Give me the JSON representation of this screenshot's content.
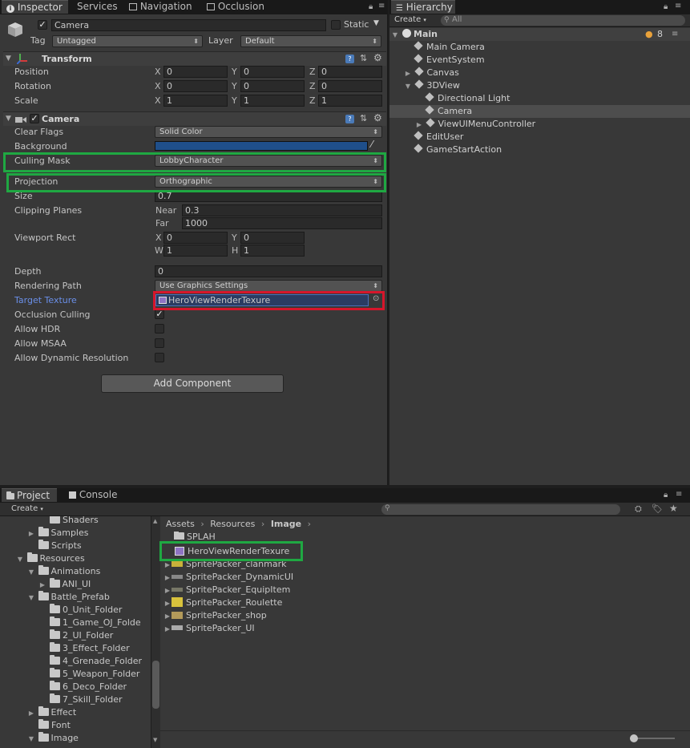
{
  "inspector_tabs": [
    {
      "label": "Inspector",
      "icon": "info-icon"
    },
    {
      "label": "Services",
      "icon": ""
    },
    {
      "label": "Navigation",
      "icon": "navigation-icon"
    },
    {
      "label": "Occlusion",
      "icon": "occlusion-icon"
    }
  ],
  "hierarchy_tab": {
    "label": "Hierarchy"
  },
  "object": {
    "name": "Camera",
    "active": true,
    "static_label": "Static",
    "tag_label": "Tag",
    "tag_value": "Untagged",
    "layer_label": "Layer",
    "layer_value": "Default"
  },
  "transform": {
    "title": "Transform",
    "rows": [
      {
        "label": "Position",
        "x": "0",
        "y": "0",
        "z": "0"
      },
      {
        "label": "Rotation",
        "x": "0",
        "y": "0",
        "z": "0"
      },
      {
        "label": "Scale",
        "x": "1",
        "y": "1",
        "z": "1"
      }
    ],
    "axis": {
      "x": "X",
      "y": "Y",
      "z": "Z"
    }
  },
  "camera": {
    "title": "Camera",
    "enabled": true,
    "clear_flags_label": "Clear Flags",
    "clear_flags_value": "Solid Color",
    "background_label": "Background",
    "background_color": "#1f4f8a",
    "culling_mask_label": "Culling Mask",
    "culling_mask_value": "LobbyCharacter",
    "projection_label": "Projection",
    "projection_value": "Orthographic",
    "size_label": "Size",
    "size_value": "0.7",
    "clipping_label": "Clipping Planes",
    "near_label": "Near",
    "near_value": "0.3",
    "far_label": "Far",
    "far_value": "1000",
    "viewport_label": "Viewport Rect",
    "vp_x_label": "X",
    "vp_x": "0",
    "vp_y_label": "Y",
    "vp_y": "0",
    "vp_w_label": "W",
    "vp_w": "1",
    "vp_h_label": "H",
    "vp_h": "1",
    "depth_label": "Depth",
    "depth_value": "0",
    "rendering_path_label": "Rendering Path",
    "rendering_path_value": "Use Graphics Settings",
    "target_texture_label": "Target Texture",
    "target_texture_value": "HeroViewRenderTexure",
    "occlusion_label": "Occlusion Culling",
    "occlusion_checked": true,
    "hdr_label": "Allow HDR",
    "msaa_label": "Allow MSAA",
    "dynres_label": "Allow Dynamic Resolution"
  },
  "add_component_label": "Add Component",
  "hierarchy": {
    "create_label": "Create",
    "search_placeholder": "All",
    "scene_name": "Main",
    "scene_badge": "8",
    "items": [
      {
        "label": "Main Camera"
      },
      {
        "label": "EventSystem"
      },
      {
        "label": "Canvas"
      },
      {
        "label": "3DView"
      },
      {
        "label": "Directional Light"
      },
      {
        "label": "Camera"
      },
      {
        "label": "ViewUIMenuController"
      },
      {
        "label": "EditUser"
      },
      {
        "label": "GameStartAction"
      }
    ]
  },
  "project_tabs": [
    {
      "label": "Project",
      "icon": "folder-icon"
    },
    {
      "label": "Console",
      "icon": "console-icon"
    }
  ],
  "project": {
    "create_label": "Create",
    "tree": [
      {
        "label": "Shaders"
      },
      {
        "label": "Samples"
      },
      {
        "label": "Scripts"
      },
      {
        "label": "Resources"
      },
      {
        "label": "Animations"
      },
      {
        "label": "ANI_UI"
      },
      {
        "label": "Battle_Prefab"
      },
      {
        "label": "0_Unit_Folder"
      },
      {
        "label": "1_Game_OJ_Folde"
      },
      {
        "label": "2_UI_Folder"
      },
      {
        "label": "3_Effect_Folder"
      },
      {
        "label": "4_Grenade_Folder"
      },
      {
        "label": "5_Weapon_Folder"
      },
      {
        "label": "6_Deco_Folder"
      },
      {
        "label": "7_Skill_Folder"
      },
      {
        "label": "Effect"
      },
      {
        "label": "Font"
      },
      {
        "label": "Image"
      }
    ],
    "breadcrumb": [
      {
        "label": "Assets"
      },
      {
        "label": "Resources"
      },
      {
        "label": "Image"
      }
    ],
    "assets": [
      {
        "label": "SPLAH"
      },
      {
        "label": "HeroViewRenderTexure"
      },
      {
        "label": "SpritePacker_clanmark"
      },
      {
        "label": "SpritePacker_DynamicUI"
      },
      {
        "label": "SpritePacker_EquipItem"
      },
      {
        "label": "SpritePacker_Roulette"
      },
      {
        "label": "SpritePacker_shop"
      },
      {
        "label": "SpritePacker_UI"
      }
    ]
  },
  "colors": {
    "highlight_green": "#1fa842",
    "highlight_red": "#d6162b",
    "link_blue": "#6a8fe8"
  }
}
